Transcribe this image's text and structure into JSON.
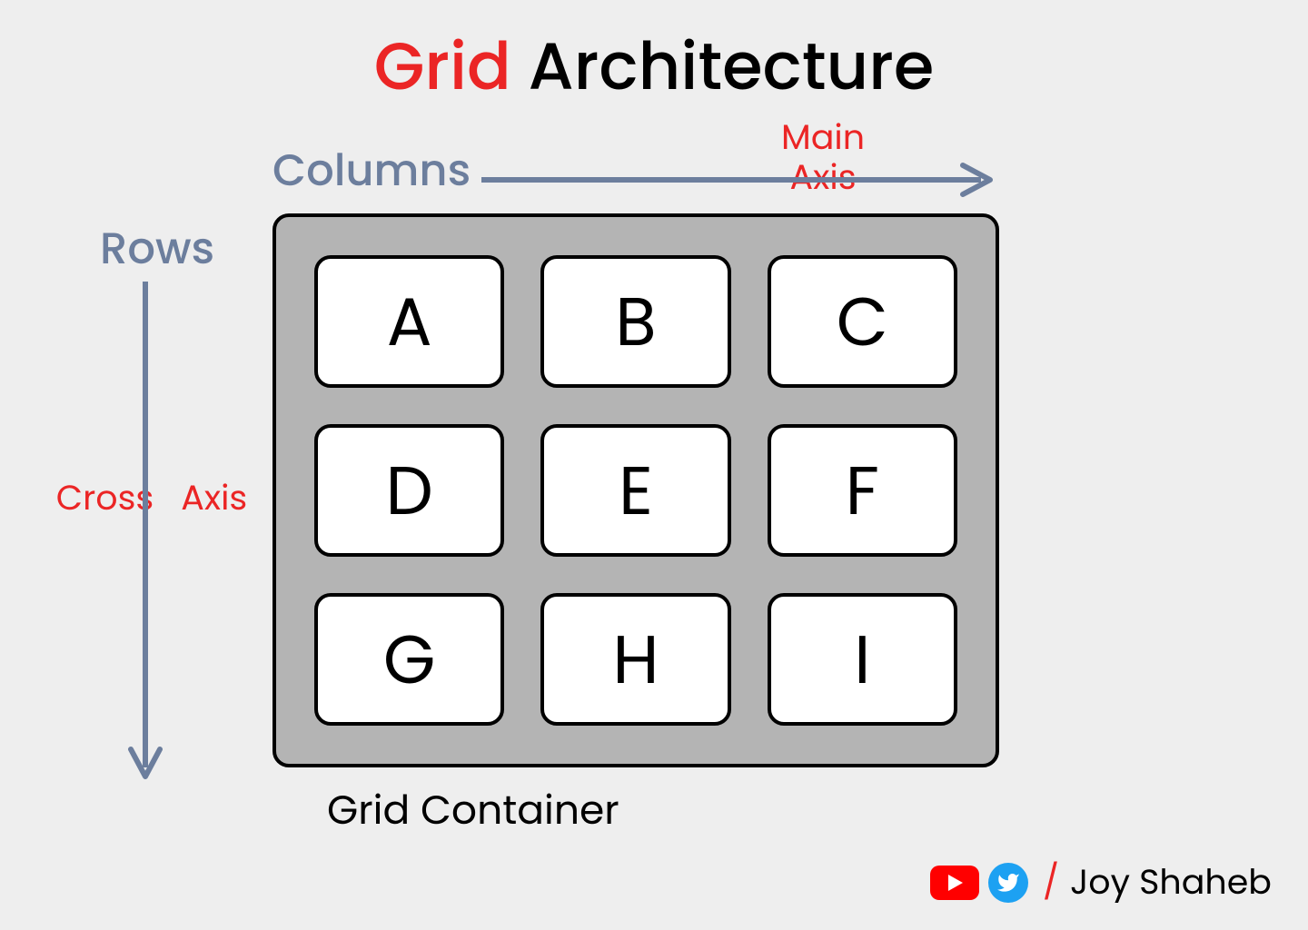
{
  "title": {
    "highlight": "Grid",
    "rest": " Architecture"
  },
  "labels": {
    "columns": "Columns",
    "rows": "Rows",
    "main_line1": "Main",
    "main_line2": "Axis",
    "cross_word": "Cross",
    "axis_word": "Axis",
    "grid_container": "Grid Container"
  },
  "cells": [
    "A",
    "B",
    "C",
    "D",
    "E",
    "F",
    "G",
    "H",
    "I"
  ],
  "credits": {
    "slash": "/",
    "name": "Joy Shaheb"
  },
  "colors": {
    "accent": "#eb2525",
    "arrow": "#6c7e9d"
  }
}
